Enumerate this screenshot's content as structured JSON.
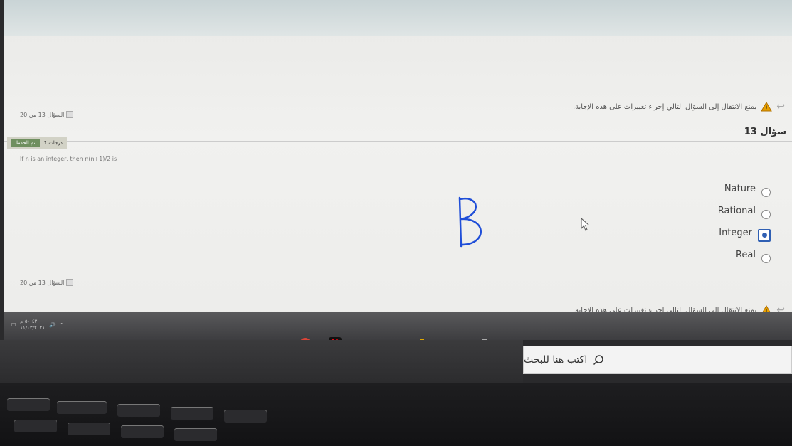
{
  "warning": {
    "text": "يمنع الانتقال إلى السؤال التالي إجراء تغييرات على هذه الإجابة."
  },
  "question": {
    "counter": "السؤال 13 من 20",
    "title": "سؤال 13",
    "grade_label": "1 درجات",
    "grade_button": "تم الحفظ",
    "text": "If n is an integer, then n(n+1)/2 is",
    "options": [
      {
        "label": "Nature",
        "selected": false
      },
      {
        "label": "Rational",
        "selected": false
      },
      {
        "label": "Integer",
        "selected": true
      },
      {
        "label": "Real",
        "selected": false
      }
    ]
  },
  "annotation": {
    "handwritten_letter": "B"
  },
  "taskbar": {
    "search_placeholder": "اكتب هنا للبحث",
    "apps": [
      "chrome-icon",
      "netflix-icon",
      "mail-icon",
      "store-icon",
      "file-explorer-icon",
      "edge-icon",
      "task-view-icon"
    ],
    "clock": "٥٠:٤٣ م",
    "date": "١١/٠٣/٢٠٢١"
  },
  "colors": {
    "accent": "#2f5fb3",
    "warning": "#e8a000"
  }
}
